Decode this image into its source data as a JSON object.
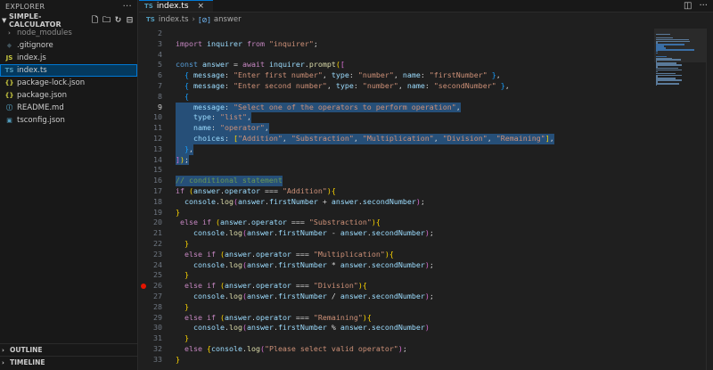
{
  "explorer": {
    "title": "EXPLORER",
    "more": "···",
    "project": "SIMPLE-CALCULATOR",
    "files": [
      {
        "name": "node_modules",
        "icon": "",
        "kind": "folder",
        "dim": true
      },
      {
        "name": ".gitignore",
        "icon": "◆",
        "kind": "git"
      },
      {
        "name": "index.js",
        "icon": "JS",
        "kind": "js"
      },
      {
        "name": "index.ts",
        "icon": "TS",
        "kind": "ts",
        "active": true
      },
      {
        "name": "package-lock.json",
        "icon": "{}",
        "kind": "json"
      },
      {
        "name": "package.json",
        "icon": "{}",
        "kind": "json"
      },
      {
        "name": "README.md",
        "icon": "ⓘ",
        "kind": "md"
      },
      {
        "name": "tsconfig.json",
        "icon": "▣",
        "kind": "cfg"
      }
    ],
    "outline": "OUTLINE",
    "timeline": "TIMELINE"
  },
  "tab": {
    "icon": "TS",
    "label": "index.ts",
    "close": "×"
  },
  "breadcrumb": {
    "icon": "TS",
    "file": "index.ts",
    "symbol": "answer"
  },
  "code_lines": [
    {
      "n": "2",
      "tokens": []
    },
    {
      "n": "3",
      "tokens": [
        [
          "k",
          "import"
        ],
        [
          "p",
          " "
        ],
        [
          "v",
          "inquirer"
        ],
        [
          "p",
          " "
        ],
        [
          "k",
          "from"
        ],
        [
          "p",
          " "
        ],
        [
          "s",
          "\"inquirer\""
        ],
        [
          "p",
          ";"
        ]
      ]
    },
    {
      "n": "4",
      "tokens": []
    },
    {
      "n": "5",
      "tokens": [
        [
          "kb",
          "const"
        ],
        [
          "p",
          " "
        ],
        [
          "v",
          "answer"
        ],
        [
          "p",
          " = "
        ],
        [
          "k",
          "await"
        ],
        [
          "p",
          " "
        ],
        [
          "v",
          "inquirer"
        ],
        [
          "p",
          "."
        ],
        [
          "f",
          "prompt"
        ],
        [
          "b1",
          "("
        ],
        [
          "b2",
          "["
        ]
      ]
    },
    {
      "n": "6",
      "tokens": [
        [
          "p",
          "  "
        ],
        [
          "b3",
          "{"
        ],
        [
          "p",
          " "
        ],
        [
          "v",
          "message"
        ],
        [
          "p",
          ": "
        ],
        [
          "s",
          "\"Enter first number\""
        ],
        [
          "p",
          ", "
        ],
        [
          "v",
          "type"
        ],
        [
          "p",
          ": "
        ],
        [
          "s",
          "\"number\""
        ],
        [
          "p",
          ", "
        ],
        [
          "v",
          "name"
        ],
        [
          "p",
          ": "
        ],
        [
          "s",
          "\"firstNumber\""
        ],
        [
          "p",
          " "
        ],
        [
          "b3",
          "}"
        ],
        [
          "p",
          ","
        ]
      ]
    },
    {
      "n": "7",
      "tokens": [
        [
          "p",
          "  "
        ],
        [
          "b3",
          "{"
        ],
        [
          "p",
          " "
        ],
        [
          "v",
          "message"
        ],
        [
          "p",
          ": "
        ],
        [
          "s",
          "\"Enter second number\""
        ],
        [
          "p",
          ", "
        ],
        [
          "v",
          "type"
        ],
        [
          "p",
          ": "
        ],
        [
          "s",
          "\"number\""
        ],
        [
          "p",
          ", "
        ],
        [
          "v",
          "name"
        ],
        [
          "p",
          ": "
        ],
        [
          "s",
          "\"secondNumber\""
        ],
        [
          "p",
          " "
        ],
        [
          "b3",
          "}"
        ],
        [
          "p",
          ","
        ]
      ]
    },
    {
      "n": "8",
      "tokens": [
        [
          "p",
          "  "
        ],
        [
          "b3",
          "{"
        ]
      ]
    },
    {
      "n": "9",
      "tokens": [
        [
          "p",
          "    "
        ],
        [
          "v",
          "message"
        ],
        [
          "p",
          ": "
        ],
        [
          "s",
          "\"Select one of the operators to perform operation\""
        ],
        [
          "p",
          ","
        ]
      ],
      "sel": true,
      "bulb": true,
      "cur": true
    },
    {
      "n": "10",
      "tokens": [
        [
          "p",
          "    "
        ],
        [
          "v",
          "type"
        ],
        [
          "p",
          ": "
        ],
        [
          "s",
          "\"list\""
        ],
        [
          "p",
          ","
        ]
      ],
      "sel": true
    },
    {
      "n": "11",
      "tokens": [
        [
          "p",
          "    "
        ],
        [
          "v",
          "name"
        ],
        [
          "p",
          ": "
        ],
        [
          "s",
          "\"operator\""
        ],
        [
          "p",
          ","
        ]
      ],
      "sel": true
    },
    {
      "n": "12",
      "tokens": [
        [
          "p",
          "    "
        ],
        [
          "v",
          "choices"
        ],
        [
          "p",
          ": "
        ],
        [
          "b1",
          "["
        ],
        [
          "s",
          "\"Addition\""
        ],
        [
          "p",
          ", "
        ],
        [
          "s",
          "\"Substraction\""
        ],
        [
          "p",
          ", "
        ],
        [
          "s",
          "\"Multiplication\""
        ],
        [
          "p",
          ", "
        ],
        [
          "s",
          "\"Division\""
        ],
        [
          "p",
          ", "
        ],
        [
          "s",
          "\"Remaining\""
        ],
        [
          "b1",
          "]"
        ],
        [
          "p",
          ","
        ]
      ],
      "sel": true
    },
    {
      "n": "13",
      "tokens": [
        [
          "p",
          "  "
        ],
        [
          "b3",
          "}"
        ],
        [
          "p",
          ","
        ]
      ],
      "sel": true
    },
    {
      "n": "14",
      "tokens": [
        [
          "b2",
          "]"
        ],
        [
          "b1",
          ")"
        ],
        [
          "p",
          ";"
        ]
      ],
      "sel": true
    },
    {
      "n": "15",
      "tokens": [],
      "sel": true
    },
    {
      "n": "16",
      "tokens": [
        [
          "c",
          "// conditional statement"
        ]
      ],
      "sel": true
    },
    {
      "n": "17",
      "tokens": [
        [
          "k",
          "if"
        ],
        [
          "p",
          " "
        ],
        [
          "b1",
          "("
        ],
        [
          "v",
          "answer"
        ],
        [
          "p",
          "."
        ],
        [
          "v",
          "operator"
        ],
        [
          "p",
          " === "
        ],
        [
          "s",
          "\"Addition\""
        ],
        [
          "b1",
          ")"
        ],
        [
          "b1",
          "{"
        ]
      ]
    },
    {
      "n": "18",
      "tokens": [
        [
          "p",
          "  "
        ],
        [
          "v",
          "console"
        ],
        [
          "p",
          "."
        ],
        [
          "f",
          "log"
        ],
        [
          "b2",
          "("
        ],
        [
          "v",
          "answer"
        ],
        [
          "p",
          "."
        ],
        [
          "v",
          "firstNumber"
        ],
        [
          "p",
          " + "
        ],
        [
          "v",
          "answer"
        ],
        [
          "p",
          "."
        ],
        [
          "v",
          "secondNumber"
        ],
        [
          "b2",
          ")"
        ],
        [
          "p",
          ";"
        ]
      ]
    },
    {
      "n": "19",
      "tokens": [
        [
          "b1",
          "}"
        ]
      ]
    },
    {
      "n": "20",
      "tokens": [
        [
          "p",
          " "
        ],
        [
          "k",
          "else"
        ],
        [
          "p",
          " "
        ],
        [
          "k",
          "if"
        ],
        [
          "p",
          " "
        ],
        [
          "b1",
          "("
        ],
        [
          "v",
          "answer"
        ],
        [
          "p",
          "."
        ],
        [
          "v",
          "operator"
        ],
        [
          "p",
          " === "
        ],
        [
          "s",
          "\"Substraction\""
        ],
        [
          "b1",
          ")"
        ],
        [
          "b1",
          "{"
        ]
      ]
    },
    {
      "n": "21",
      "tokens": [
        [
          "p",
          "    "
        ],
        [
          "v",
          "console"
        ],
        [
          "p",
          "."
        ],
        [
          "f",
          "log"
        ],
        [
          "b2",
          "("
        ],
        [
          "v",
          "answer"
        ],
        [
          "p",
          "."
        ],
        [
          "v",
          "firstNumber"
        ],
        [
          "p",
          " - "
        ],
        [
          "v",
          "answer"
        ],
        [
          "p",
          "."
        ],
        [
          "v",
          "secondNumber"
        ],
        [
          "b2",
          ")"
        ],
        [
          "p",
          ";"
        ]
      ]
    },
    {
      "n": "22",
      "tokens": [
        [
          "p",
          "  "
        ],
        [
          "b1",
          "}"
        ]
      ]
    },
    {
      "n": "23",
      "tokens": [
        [
          "p",
          "  "
        ],
        [
          "k",
          "else"
        ],
        [
          "p",
          " "
        ],
        [
          "k",
          "if"
        ],
        [
          "p",
          " "
        ],
        [
          "b1",
          "("
        ],
        [
          "v",
          "answer"
        ],
        [
          "p",
          "."
        ],
        [
          "v",
          "operator"
        ],
        [
          "p",
          " === "
        ],
        [
          "s",
          "\"Multiplication\""
        ],
        [
          "b1",
          ")"
        ],
        [
          "b1",
          "{"
        ]
      ]
    },
    {
      "n": "24",
      "tokens": [
        [
          "p",
          "    "
        ],
        [
          "v",
          "console"
        ],
        [
          "p",
          "."
        ],
        [
          "f",
          "log"
        ],
        [
          "b2",
          "("
        ],
        [
          "v",
          "answer"
        ],
        [
          "p",
          "."
        ],
        [
          "v",
          "firstNumber"
        ],
        [
          "p",
          " * "
        ],
        [
          "v",
          "answer"
        ],
        [
          "p",
          "."
        ],
        [
          "v",
          "secondNumber"
        ],
        [
          "b2",
          ")"
        ],
        [
          "p",
          ";"
        ]
      ]
    },
    {
      "n": "25",
      "tokens": [
        [
          "p",
          "  "
        ],
        [
          "b1",
          "}"
        ]
      ]
    },
    {
      "n": "26",
      "tokens": [
        [
          "p",
          "  "
        ],
        [
          "k",
          "else"
        ],
        [
          "p",
          " "
        ],
        [
          "k",
          "if"
        ],
        [
          "p",
          " "
        ],
        [
          "b1",
          "("
        ],
        [
          "v",
          "answer"
        ],
        [
          "p",
          "."
        ],
        [
          "v",
          "operator"
        ],
        [
          "p",
          " === "
        ],
        [
          "s",
          "\"Division\""
        ],
        [
          "b1",
          ")"
        ],
        [
          "b1",
          "{"
        ]
      ],
      "bp": true
    },
    {
      "n": "27",
      "tokens": [
        [
          "p",
          "    "
        ],
        [
          "v",
          "console"
        ],
        [
          "p",
          "."
        ],
        [
          "f",
          "log"
        ],
        [
          "b2",
          "("
        ],
        [
          "v",
          "answer"
        ],
        [
          "p",
          "."
        ],
        [
          "v",
          "firstNumber"
        ],
        [
          "p",
          " / "
        ],
        [
          "v",
          "answer"
        ],
        [
          "p",
          "."
        ],
        [
          "v",
          "secondNumber"
        ],
        [
          "b2",
          ")"
        ],
        [
          "p",
          ";"
        ]
      ]
    },
    {
      "n": "28",
      "tokens": [
        [
          "p",
          "  "
        ],
        [
          "b1",
          "}"
        ]
      ]
    },
    {
      "n": "29",
      "tokens": [
        [
          "p",
          "  "
        ],
        [
          "k",
          "else"
        ],
        [
          "p",
          " "
        ],
        [
          "k",
          "if"
        ],
        [
          "p",
          " "
        ],
        [
          "b1",
          "("
        ],
        [
          "v",
          "answer"
        ],
        [
          "p",
          "."
        ],
        [
          "v",
          "operator"
        ],
        [
          "p",
          " === "
        ],
        [
          "s",
          "\"Remaining\""
        ],
        [
          "b1",
          ")"
        ],
        [
          "b1",
          "{"
        ]
      ]
    },
    {
      "n": "30",
      "tokens": [
        [
          "p",
          "    "
        ],
        [
          "v",
          "console"
        ],
        [
          "p",
          "."
        ],
        [
          "f",
          "log"
        ],
        [
          "b2",
          "("
        ],
        [
          "v",
          "answer"
        ],
        [
          "p",
          "."
        ],
        [
          "v",
          "firstNumber"
        ],
        [
          "p",
          " % "
        ],
        [
          "v",
          "answer"
        ],
        [
          "p",
          "."
        ],
        [
          "v",
          "secondNumber"
        ],
        [
          "b2",
          ")"
        ]
      ]
    },
    {
      "n": "31",
      "tokens": [
        [
          "p",
          "  "
        ],
        [
          "b1",
          "}"
        ]
      ]
    },
    {
      "n": "32",
      "tokens": [
        [
          "p",
          "  "
        ],
        [
          "k",
          "else"
        ],
        [
          "p",
          " "
        ],
        [
          "b1",
          "{"
        ],
        [
          "v",
          "console"
        ],
        [
          "p",
          "."
        ],
        [
          "f",
          "log"
        ],
        [
          "b2",
          "("
        ],
        [
          "s",
          "\"Please select valid operator\""
        ],
        [
          "b2",
          ")"
        ],
        [
          "p",
          ";"
        ]
      ]
    },
    {
      "n": "33",
      "tokens": [
        [
          "b1",
          "}"
        ]
      ]
    }
  ],
  "colors": {
    "accent": "#0078d4",
    "breakpoint": "#e51400",
    "selection": "#264f78"
  }
}
